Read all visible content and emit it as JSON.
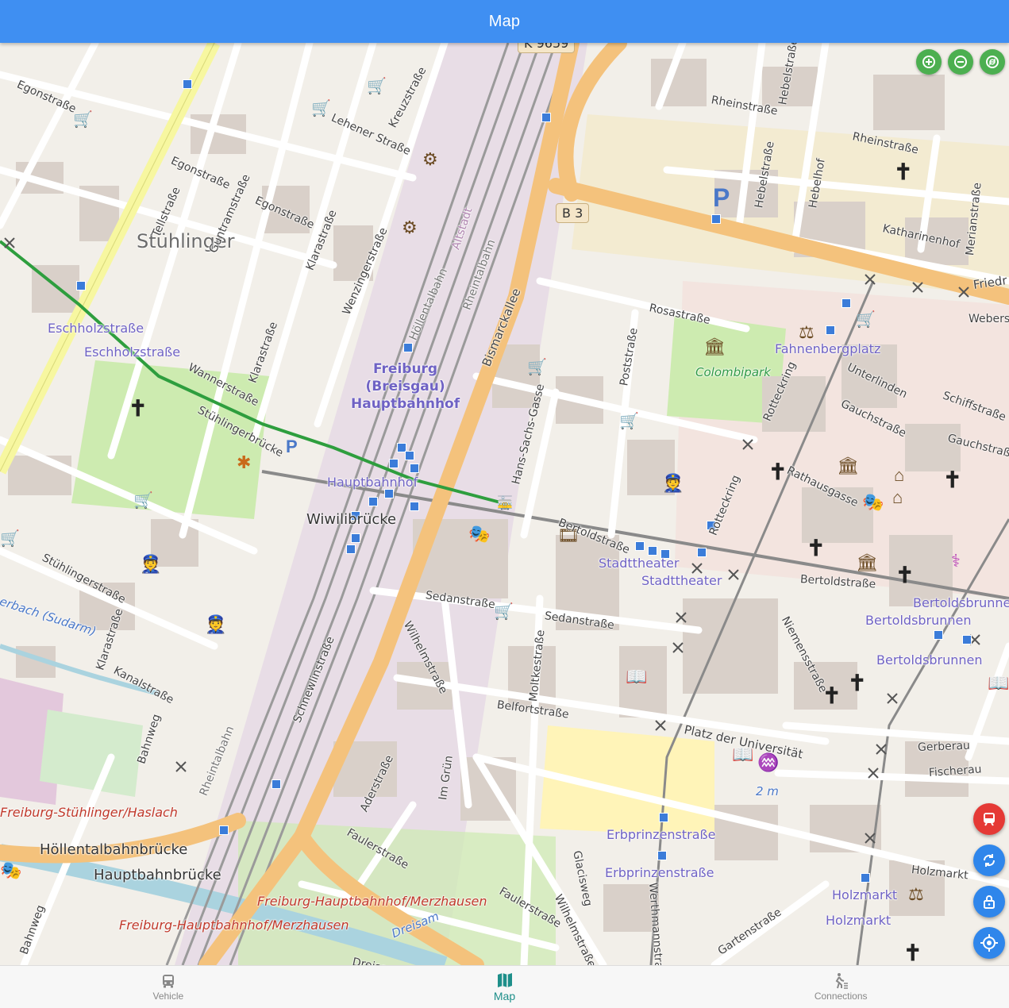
{
  "app_bar": {
    "title": "Map"
  },
  "map": {
    "districts": [
      {
        "name": "Stühlinger"
      }
    ],
    "station": {
      "line1": "Freiburg",
      "line2": "(Breisgau)",
      "line3": "Hauptbahnhof"
    },
    "road_shields": [
      "B 3",
      "K 9659"
    ],
    "streets": [
      "Egonstraße",
      "Egonstraße",
      "Egonstraße",
      "Lehener Straße",
      "Kreuzstraße",
      "Tellstraße",
      "Guntramstraße",
      "Klarastraße",
      "Wenzingerstraße",
      "Klarastraße",
      "Wannerstraße",
      "Stühlingerbrücke",
      "Stühlingerstraße",
      "Klarastraße",
      "Kanalstraße",
      "Bahnweg",
      "Bismarckallee",
      "Rheinstraße",
      "Rheinstraße",
      "Hebelstraße",
      "Hebelstraße",
      "Hebelhof",
      "Katharinenhof",
      "Merianstraße",
      "Rosastraße",
      "Poststraße",
      "Hans-Sachs-Gasse",
      "Rotteckring",
      "Rotteckring",
      "Unterlinden",
      "Gauchstraße",
      "Gauchstraße",
      "Schiffstraße",
      "Webers",
      "Rathausgasse",
      "Bertoldstraße",
      "Bertoldstraße",
      "Niemensstraße",
      "Sedanstraße",
      "Sedanstraße",
      "Wilhelmstraße",
      "Moltkestraße",
      "Belfortstraße",
      "Schnewlinstraße",
      "Platz der Universität",
      "Gerberau",
      "Fischerau",
      "Erbprinzenstraße",
      "Glacisweg",
      "Wilhelmstraße",
      "Werthmannstraße",
      "Faulerstraße",
      "Faulerstraße",
      "Aderstraße",
      "Im Grün",
      "Holzmarkt",
      "Gartenstraße",
      "Dreisamstraße",
      "Friedr",
      "Bahnweg",
      "Rheintalbahn",
      "Höllentalbahn",
      "Rheintalbahn",
      "Altstadt",
      "Rheintalbahn"
    ],
    "transit_stops": [
      "Eschholzstraße",
      "Eschholzstraße",
      "Hauptbahnhof",
      "Stadttheater",
      "Stadttheater",
      "Fahnenbergplatz",
      "Bertoldsbrunnen",
      "Bertoldsbrunnen",
      "Bertoldsbrunnen",
      "Erbprinzenstraße",
      "Erbprinzenstraße",
      "Holzmarkt",
      "Holzmarkt",
      "Freiburg-Stühlinger/Haslach",
      "Freiburg-Hauptbahnhof/Merzhausen",
      "Freiburg-Hauptbahnhof/Merzhausen"
    ],
    "bridges": [
      "Wiwilibrücke",
      "Höllentalbahnbrücke",
      "Hauptbahnbrücke"
    ],
    "parks": [
      "Colombipark"
    ],
    "water": [
      "Dreisam",
      "erbach (Sudarm)",
      "2 m"
    ],
    "route_color": "#2e9e3e",
    "zoom_controls": {
      "zoom_in_icon": "zoom-in-icon",
      "zoom_out_icon": "zoom-out-icon",
      "refresh_icon": "refresh-icon"
    },
    "fabs": [
      {
        "icon": "train-icon",
        "color": "#e53935"
      },
      {
        "icon": "sync-icon",
        "color": "#2f86eb"
      },
      {
        "icon": "lock-open-icon",
        "color": "#2f86eb"
      },
      {
        "icon": "my-location-icon",
        "color": "#2f86eb"
      }
    ]
  },
  "bottom_nav": {
    "items": [
      {
        "label": "Vehicle",
        "icon": "bus-icon",
        "active": false
      },
      {
        "label": "Map",
        "icon": "map-icon",
        "active": true
      },
      {
        "label": "Connections",
        "icon": "walk-icon",
        "active": false
      }
    ]
  },
  "colors": {
    "app_bar": "#3f8ff2",
    "nav_active": "#1e8f8a",
    "nav_inactive": "#888888"
  }
}
